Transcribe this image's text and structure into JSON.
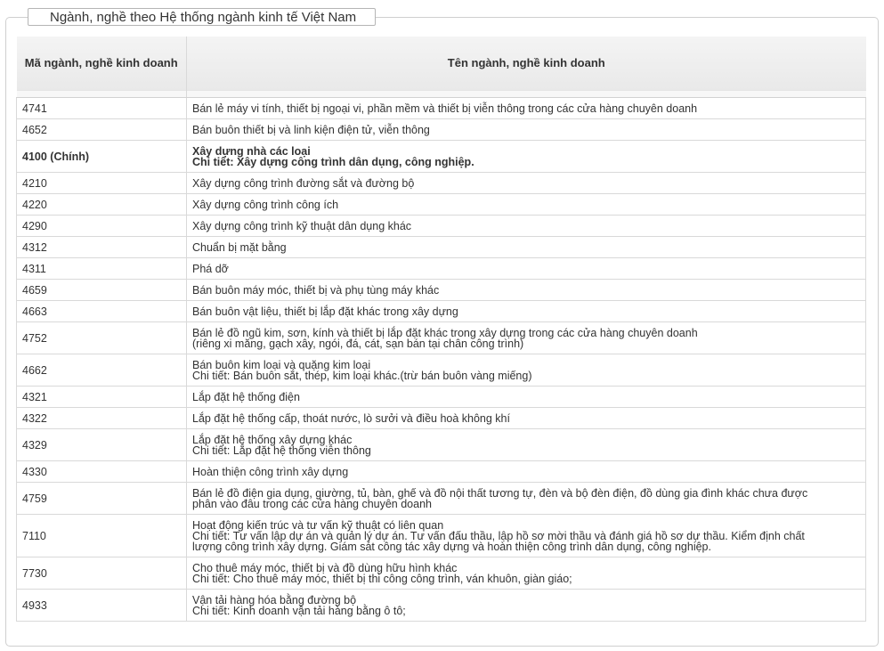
{
  "section": {
    "legend": "Ngành, nghề theo Hệ thống ngành kinh tế Việt Nam"
  },
  "table": {
    "headers": {
      "code": "Mã ngành, nghề kinh doanh",
      "name": "Tên ngành, nghề kinh doanh"
    },
    "rows": [
      {
        "code": "4741",
        "lines": [
          "Bán lẻ máy vi tính, thiết bị ngoại vi, phần mềm và thiết bị viễn thông trong các cửa hàng chuyên doanh"
        ],
        "size": "r1"
      },
      {
        "code": "4652",
        "lines": [
          "Bán buôn thiết bị và linh kiện điện tử, viễn thông"
        ],
        "size": "r1"
      },
      {
        "code": "4100 (Chính)",
        "lines": [
          "Xây dựng nhà các loại",
          "Chi tiết: Xây dựng công trình dân dụng, công nghiệp."
        ],
        "size": "r2",
        "main": true
      },
      {
        "code": "4210",
        "lines": [
          "Xây dựng công trình đường sắt và đường bộ"
        ],
        "size": "r1"
      },
      {
        "code": "4220",
        "lines": [
          "Xây dựng công trình công ích"
        ],
        "size": "r1"
      },
      {
        "code": "4290",
        "lines": [
          "Xây dựng công trình kỹ thuật dân dụng khác"
        ],
        "size": "r1"
      },
      {
        "code": "4312",
        "lines": [
          "Chuẩn bị mặt bằng"
        ],
        "size": "r1"
      },
      {
        "code": "4311",
        "lines": [
          "Phá dỡ"
        ],
        "size": "r1"
      },
      {
        "code": "4659",
        "lines": [
          "Bán buôn máy móc, thiết bị và phụ tùng máy khác"
        ],
        "size": "r1"
      },
      {
        "code": "4663",
        "lines": [
          "Bán buôn vật liệu, thiết bị lắp đặt khác trong xây dựng"
        ],
        "size": "r1"
      },
      {
        "code": "4752",
        "lines": [
          "Bán lẻ đồ ngũ kim, sơn, kính và thiết bị lắp đặt khác trong xây dựng trong các cửa hàng chuyên doanh",
          "(riêng xi măng, gạch xây, ngói, đá, cát, sạn bán tại chân công trình)"
        ],
        "size": "r2"
      },
      {
        "code": "4662",
        "lines": [
          "Bán buôn kim loại và quặng kim loại",
          "Chi tiết: Bán buôn sắt, thép, kim loại khác.(trừ bán buôn vàng miếng)"
        ],
        "size": "r2"
      },
      {
        "code": "4321",
        "lines": [
          "Lắp đặt hệ thống điện"
        ],
        "size": "r1"
      },
      {
        "code": "4322",
        "lines": [
          "Lắp đặt hệ thống cấp, thoát nước, lò sưởi và điều hoà không khí"
        ],
        "size": "r1"
      },
      {
        "code": "4329",
        "lines": [
          "Lắp đặt hệ thống xây dựng khác",
          "Chi tiết: Lắp đặt hệ thống viễn thông"
        ],
        "size": "r2"
      },
      {
        "code": "4330",
        "lines": [
          "Hoàn thiện công trình xây dựng"
        ],
        "size": "r1"
      },
      {
        "code": "4759",
        "lines": [
          "Bán lẻ đồ điện gia dụng, giường, tủ, bàn, ghế và đồ nội thất tương tự, đèn và bộ đèn điện, đồ dùng gia đình khác chưa được",
          "phân vào đâu trong các cửa hàng chuyên doanh"
        ],
        "size": "r2"
      },
      {
        "code": "7110",
        "lines": [
          "Hoạt động kiến trúc và tư vấn kỹ thuật có liên quan",
          "Chi tiết: Tư vấn lập dự án và quản lý dự án. Tư vấn đấu thầu, lập hồ sơ mời thầu và đánh giá hồ sơ dự thầu. Kiểm định chất",
          "lượng công trình xây dựng. Giám sát công tác xây dựng và hoàn thiện công trình dân dụng, công nghiệp."
        ],
        "size": "r3"
      },
      {
        "code": "7730",
        "lines": [
          "Cho thuê máy móc, thiết bị và đồ dùng hữu hình khác",
          "Chi tiết: Cho thuê máy móc, thiết bị thi công công trình, ván khuôn, giàn giáo;"
        ],
        "size": "r2"
      },
      {
        "code": "4933",
        "lines": [
          "Vận tải hàng hóa bằng đường bộ",
          "Chi tiết: Kinh doanh vận tải hàng bằng ô tô;"
        ],
        "size": "r2"
      }
    ]
  }
}
